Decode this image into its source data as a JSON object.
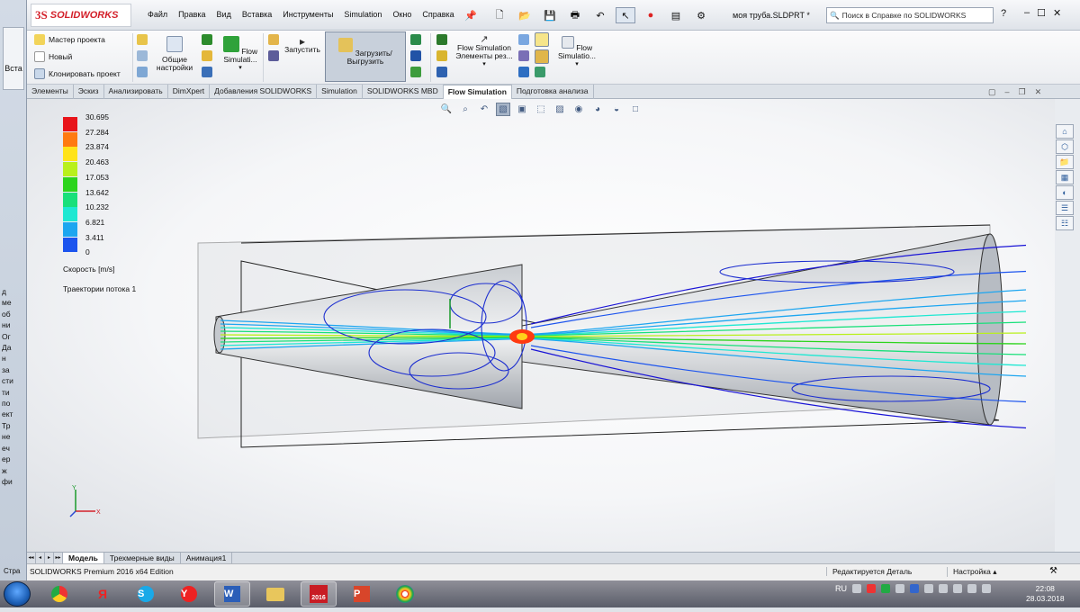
{
  "left_strip": {
    "tab_label": "Вста",
    "bottom_label": "Стра",
    "letters": [
      "д",
      "ме",
      "об",
      "ни",
      "Ог",
      "Да",
      "н",
      "за",
      "сти",
      "ти",
      "по",
      "ект",
      "Тр",
      "не",
      "еч",
      "ер",
      "ж",
      "фи"
    ]
  },
  "app": {
    "logo_text": "SOLIDWORKS",
    "menu": [
      "Файл",
      "Правка",
      "Вид",
      "Вставка",
      "Инструменты",
      "Simulation",
      "Окно",
      "Справка"
    ],
    "doc_title": "моя труба.SLDPRT *",
    "search_placeholder": "Поиск в Справке по SOLIDWORKS",
    "help_label": "?"
  },
  "ribbon": {
    "left_items": [
      "Мастер проекта",
      "Новый",
      "Клонировать проект"
    ],
    "general_settings": "Общие настройки",
    "flow_sim1": "Flow Simulati...",
    "run": "Запустить",
    "load_unload": "Загрузить/Выгрузить",
    "flow_results": "Flow Simulation Элементы рез...",
    "flow_sim2": "Flow Simulatio..."
  },
  "command_tabs": [
    "Элементы",
    "Эскиз",
    "Анализировать",
    "DimXpert",
    "Добавления SOLIDWORKS",
    "Simulation",
    "SOLIDWORKS MBD",
    "Flow Simulation",
    "Подготовка анализа"
  ],
  "active_command_tab": "Flow Simulation",
  "legend": {
    "values": [
      "30.695",
      "27.284",
      "23.874",
      "20.463",
      "17.053",
      "13.642",
      "10.232",
      "6.821",
      "3.411",
      "0"
    ],
    "colors": [
      "#e8141a",
      "#ff7a10",
      "#ffe31a",
      "#b9f01c",
      "#2cd41c",
      "#19e07a",
      "#1ee8d2",
      "#1da6f0",
      "#1c54ee",
      "#1a14d6"
    ],
    "unit": "Скорость [m/s]",
    "trajectory_label": "Траектории потока 1"
  },
  "triad": {
    "y": "Y",
    "x": "X"
  },
  "bottom_tabs": [
    "Модель",
    "Трехмерные виды",
    "Анимация1"
  ],
  "active_bottom_tab": "Модель",
  "status": {
    "edition": "SOLIDWORKS Premium 2016 x64 Edition",
    "editing": "Редактируется Деталь",
    "settings": "Настройка"
  },
  "taskbar": {
    "lang": "RU",
    "time": "22:08",
    "date": "28.03.2018",
    "apps": [
      "chrome",
      "yandex",
      "skype",
      "yandex-browser",
      "word",
      "explorer",
      "solidworks",
      "powerpoint",
      "paint"
    ],
    "solidworks_badge": "2016"
  }
}
